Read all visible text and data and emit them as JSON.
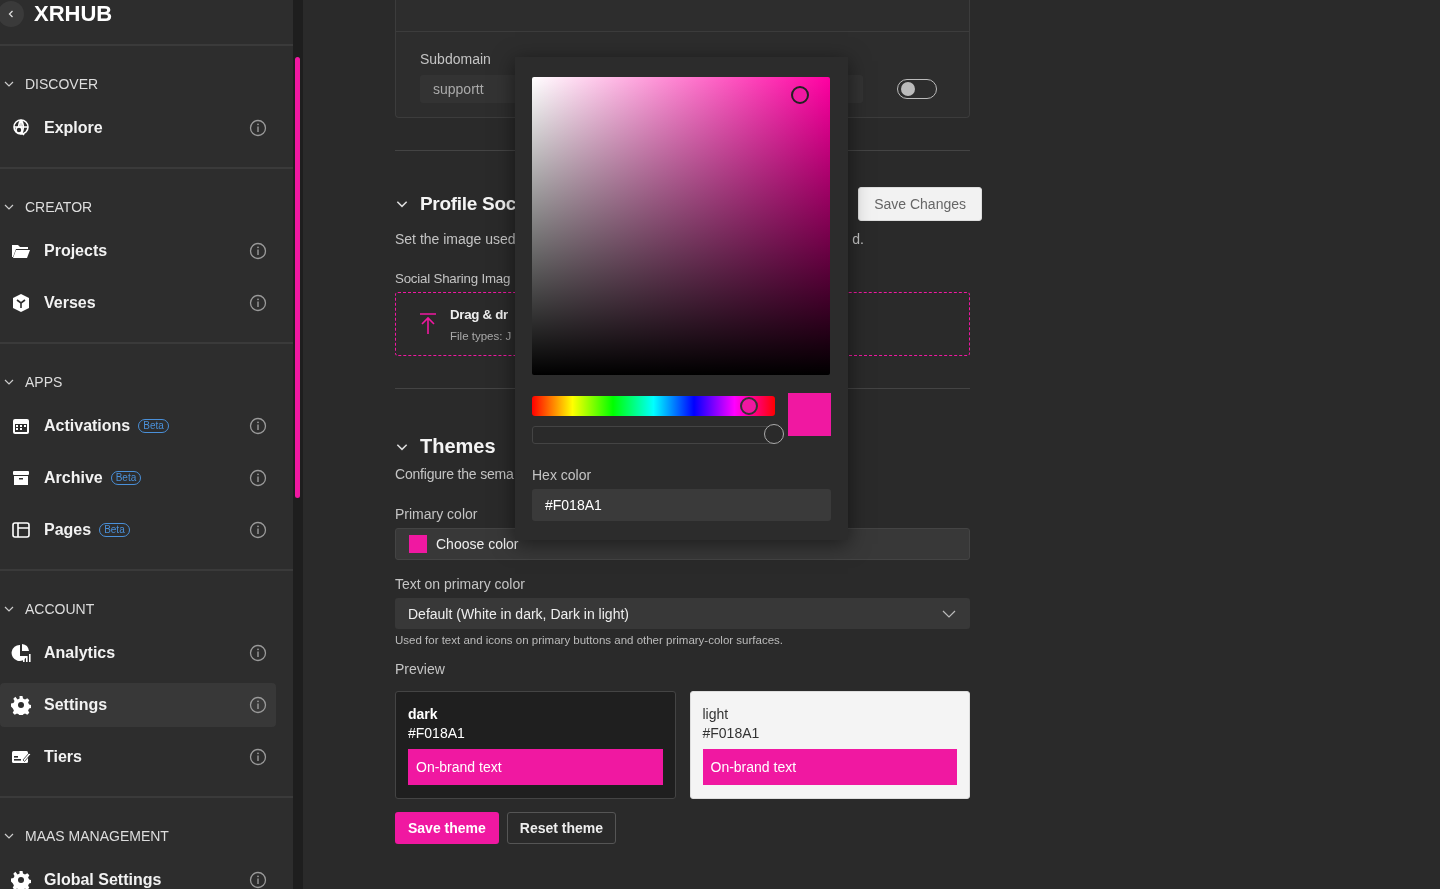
{
  "brand": "XRHUB",
  "sidebar": {
    "sections": [
      {
        "title": "DISCOVER",
        "expanded": true,
        "items": [
          {
            "label": "Explore",
            "selected": false
          }
        ]
      },
      {
        "title": "CREATOR",
        "expanded": true,
        "items": [
          {
            "label": "Projects",
            "selected": false
          },
          {
            "label": "Verses",
            "selected": false
          }
        ]
      },
      {
        "title": "APPS",
        "expanded": true,
        "items": [
          {
            "label": "Activations",
            "badge": "Beta",
            "selected": false
          },
          {
            "label": "Archive",
            "badge": "Beta",
            "selected": false
          },
          {
            "label": "Pages",
            "badge": "Beta",
            "selected": false
          }
        ]
      },
      {
        "title": "ACCOUNT",
        "expanded": true,
        "items": [
          {
            "label": "Analytics",
            "selected": false
          },
          {
            "label": "Settings",
            "selected": true
          },
          {
            "label": "Tiers",
            "selected": false
          }
        ]
      },
      {
        "title": "MAAS MANAGEMENT",
        "expanded": true,
        "items": [
          {
            "label": "Global Settings",
            "selected": false
          }
        ]
      }
    ]
  },
  "subdomain": {
    "label": "Subdomain",
    "value": "supportt",
    "toggle_on": false
  },
  "profile_social": {
    "title": "Profile Soc",
    "expanded": true,
    "description": "Set the image used",
    "description_tail": "d.",
    "save_button": "Save Changes",
    "image_label": "Social Sharing Imag",
    "drop_title": "Drag & dr",
    "drop_hint": "File types: J"
  },
  "themes": {
    "title": "Themes",
    "expanded": true,
    "description": "Configure the sema",
    "primary_label": "Primary color",
    "choose_label": "Choose color",
    "text_label": "Text on primary color",
    "text_value": "Default (White in dark, Dark in light)",
    "text_hint": "Used for text and icons on primary buttons and other primary-color surfaces.",
    "preview_label": "Preview",
    "previews": [
      {
        "kind": "dark",
        "name": "dark",
        "hex": "#F018A1",
        "sample": "On-brand text"
      },
      {
        "kind": "light",
        "name": "light",
        "hex": "#F018A1",
        "sample": "On-brand text"
      }
    ],
    "buttons": [
      {
        "label": "Save theme",
        "kind": "primary"
      },
      {
        "label": "Reset theme",
        "kind": "secondary"
      }
    ]
  },
  "picker": {
    "alpha": {
      "level": 1
    },
    "hex_label": "Hex color",
    "hex_value": "#F018A1"
  }
}
